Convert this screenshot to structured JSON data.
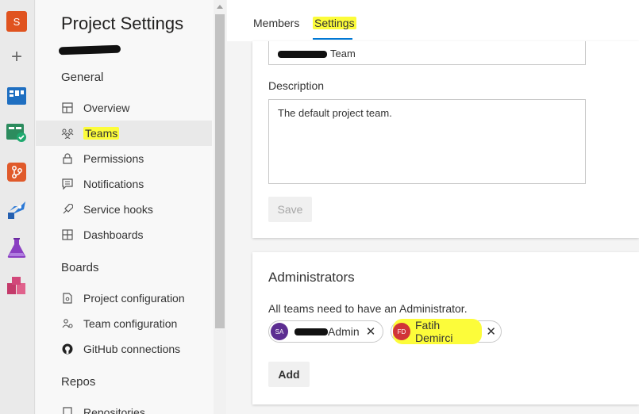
{
  "rail": {
    "org_initial": "S",
    "icons": [
      "new-icon",
      "boards-icon",
      "test-plans-icon",
      "repos-icon",
      "pipelines-icon",
      "flask-icon",
      "artifacts-icon"
    ]
  },
  "nav": {
    "title": "Project Settings",
    "sections": [
      {
        "label": "General",
        "items": [
          {
            "label": "Overview",
            "icon": "overview-icon"
          },
          {
            "label": "Teams",
            "icon": "teams-icon",
            "selected": true
          },
          {
            "label": "Permissions",
            "icon": "lock-icon"
          },
          {
            "label": "Notifications",
            "icon": "notification-icon"
          },
          {
            "label": "Service hooks",
            "icon": "service-hooks-icon"
          },
          {
            "label": "Dashboards",
            "icon": "dashboard-icon"
          }
        ]
      },
      {
        "label": "Boards",
        "items": [
          {
            "label": "Project configuration",
            "icon": "document-icon"
          },
          {
            "label": "Team configuration",
            "icon": "team-config-icon"
          },
          {
            "label": "GitHub connections",
            "icon": "github-icon"
          }
        ]
      },
      {
        "label": "Repos",
        "items": [
          {
            "label": "Repositories",
            "icon": "repo-icon"
          }
        ]
      }
    ]
  },
  "tabs": {
    "members": "Members",
    "settings": "Settings"
  },
  "settings_card": {
    "team_name_suffix": "Team",
    "description_label": "Description",
    "description_value": "The default project team.",
    "save_label": "Save"
  },
  "admins_card": {
    "title": "Administrators",
    "note": "All teams need to have an Administrator.",
    "admins": [
      {
        "initials": "SA",
        "name_suffix": "Admin"
      },
      {
        "initials": "FD",
        "name": "Fatih Demirci"
      }
    ],
    "add_label": "Add"
  },
  "colors": {
    "accent": "#0078d4",
    "highlight": "#fcfc3a",
    "org_avatar": "#e0531f"
  }
}
